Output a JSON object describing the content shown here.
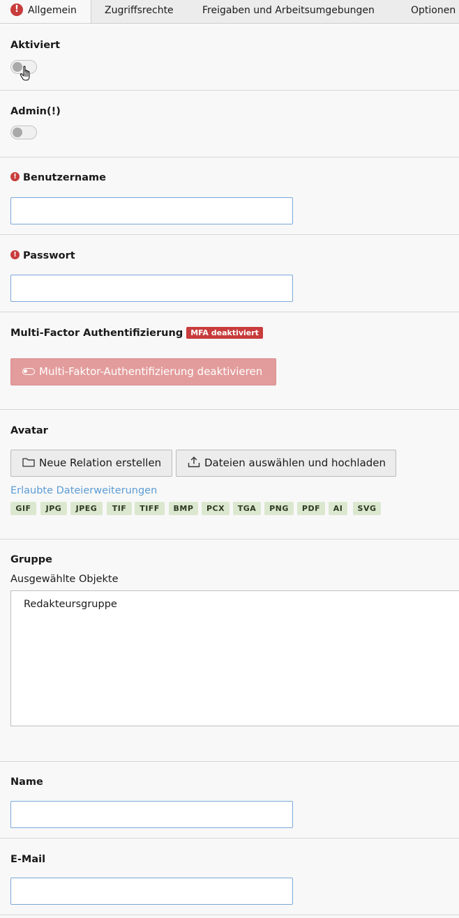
{
  "tabs": [
    {
      "label": "Allgemein",
      "active": true,
      "has_error": true
    },
    {
      "label": "Zugriffsrechte",
      "active": false
    },
    {
      "label": "Freigaben und Arbeitsumgebungen",
      "active": false
    },
    {
      "label": "Optionen",
      "active": false
    }
  ],
  "fields": {
    "aktiviert": {
      "label": "Aktiviert",
      "checked": false
    },
    "admin": {
      "label": "Admin(!)",
      "checked": false
    },
    "benutzername": {
      "label": "Benutzername",
      "required": true,
      "value": ""
    },
    "passwort": {
      "label": "Passwort",
      "required": true,
      "value": ""
    },
    "mfa": {
      "label": "Multi-Factor Authentifizierung",
      "badge": "MFA deaktiviert",
      "button_label": "Multi-Faktor-Authentifizierung deaktivieren"
    },
    "avatar": {
      "label": "Avatar",
      "new_relation_label": "Neue Relation erstellen",
      "upload_label": "Dateien auswählen und hochladen",
      "allowed_label": "Erlaubte Dateierweiterungen",
      "extensions": [
        "GIF",
        "JPG",
        "JPEG",
        "TIF",
        "TIFF",
        "BMP",
        "PCX",
        "TGA",
        "PNG",
        "PDF",
        "AI",
        "SVG"
      ]
    },
    "gruppe": {
      "label": "Gruppe",
      "selected_label": "Ausgewählte Objekte",
      "items": [
        "Redakteursgruppe"
      ]
    },
    "name": {
      "label": "Name",
      "value": ""
    },
    "email": {
      "label": "E-Mail",
      "value": ""
    }
  },
  "colors": {
    "error": "#c83c3c",
    "input_border": "#7aa7d8",
    "mfa_button": "#e39c9c",
    "extension_badge": "#dbe8cf",
    "link": "#5b9bd5"
  }
}
